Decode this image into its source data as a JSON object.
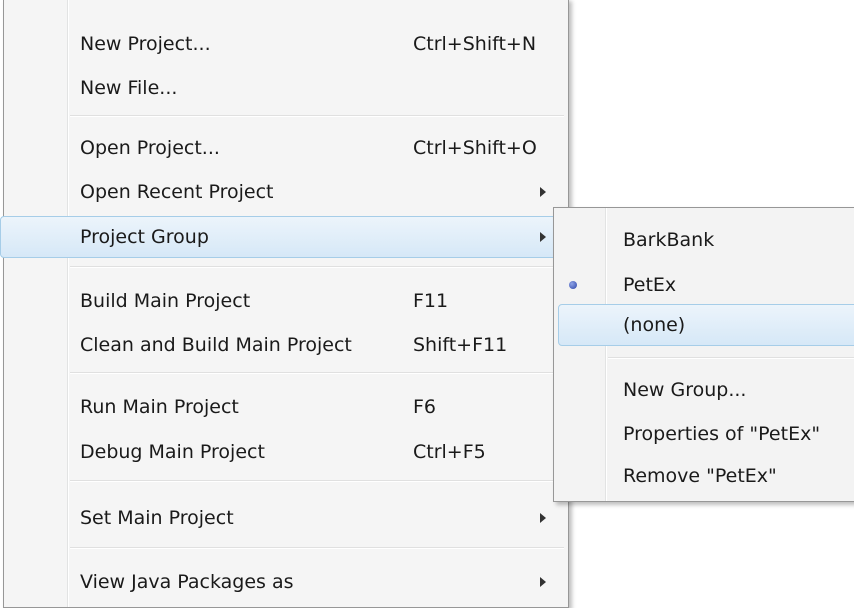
{
  "main_menu": {
    "items": [
      {
        "label": "New Project...",
        "shortcut": "Ctrl+Shift+N"
      },
      {
        "label": "New File...",
        "shortcut": ""
      },
      {
        "label": "Open Project...",
        "shortcut": "Ctrl+Shift+O"
      },
      {
        "label": "Open Recent Project",
        "shortcut": ""
      },
      {
        "label": "Project Group",
        "shortcut": ""
      },
      {
        "label": "Build Main Project",
        "shortcut": "F11"
      },
      {
        "label": "Clean and Build Main Project",
        "shortcut": "Shift+F11"
      },
      {
        "label": "Run Main Project",
        "shortcut": "F6"
      },
      {
        "label": "Debug Main Project",
        "shortcut": "Ctrl+F5"
      },
      {
        "label": "Set Main Project",
        "shortcut": ""
      },
      {
        "label": "View Java Packages as",
        "shortcut": ""
      }
    ],
    "highlighted": "Project Group"
  },
  "sub_menu": {
    "items": [
      {
        "label": "BarkBank"
      },
      {
        "label": "PetEx"
      },
      {
        "label": "(none)"
      },
      {
        "label": "New Group..."
      },
      {
        "label": "Properties of \"PetEx\""
      },
      {
        "label": "Remove \"PetEx\""
      }
    ],
    "selected": "PetEx",
    "highlighted": "(none)"
  },
  "icons": {
    "submenu_arrow": "chevron-right-icon",
    "selected_radio": "radio-selected-icon"
  },
  "colors": {
    "menu_background": "#f5f5f5",
    "highlight_border": "#a6cde8",
    "highlight_fill": "#dcebf8",
    "radio_dot": "#2c45a8"
  }
}
